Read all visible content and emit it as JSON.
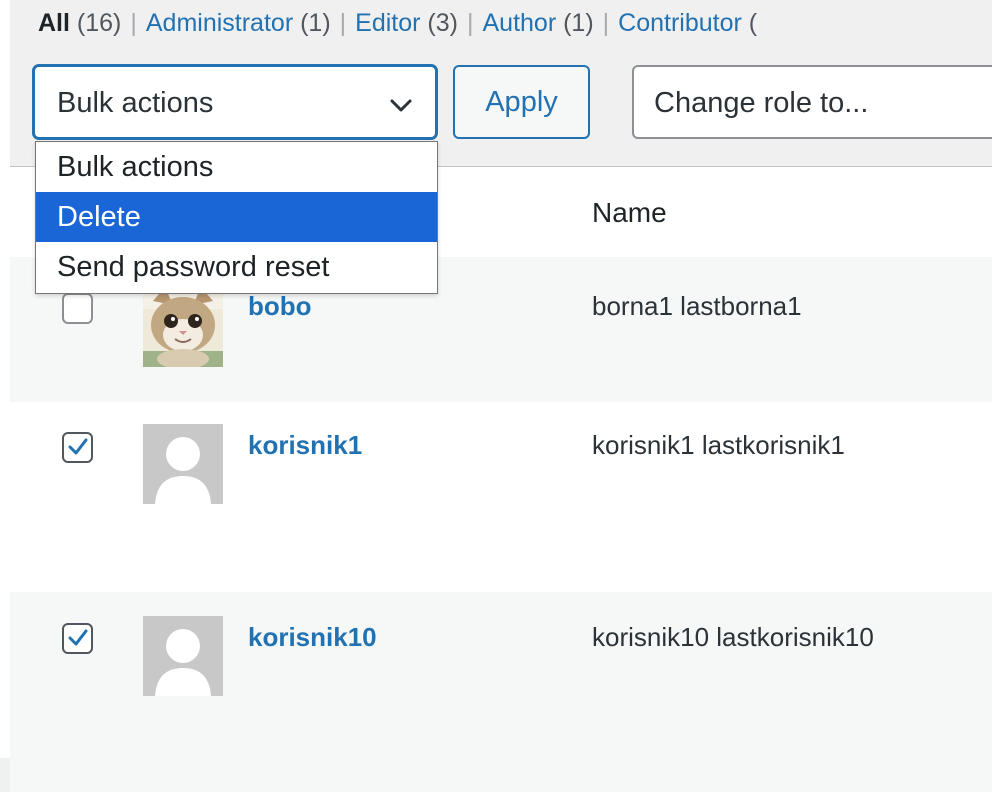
{
  "filters": {
    "all_label": "All",
    "all_count": "(16)",
    "links": [
      {
        "label": "Administrator",
        "count": "(1)"
      },
      {
        "label": "Editor",
        "count": "(3)"
      },
      {
        "label": "Author",
        "count": "(1)"
      },
      {
        "label": "Contributor",
        "count": "("
      }
    ],
    "separator": "|"
  },
  "toolbar": {
    "bulk_actions_value": "Bulk actions",
    "apply_label": "Apply",
    "change_role_value": "Change role to..."
  },
  "bulk_dropdown": {
    "options": [
      "Bulk actions",
      "Delete",
      "Send password reset"
    ],
    "highlighted": "Delete"
  },
  "table": {
    "columns": {
      "name": "Name"
    },
    "rows": [
      {
        "username": "bobo",
        "name": "borna1 lastborna1",
        "checked": false,
        "avatar": "cat-photo"
      },
      {
        "username": "korisnik1",
        "name": "korisnik1 lastkorisnik1",
        "checked": true,
        "avatar": "default-avatar"
      },
      {
        "username": "korisnik10",
        "name": "korisnik10 lastkorisnik10",
        "checked": true,
        "avatar": "default-avatar"
      }
    ]
  },
  "colors": {
    "link": "#2271b1",
    "highlight": "#1a66d6",
    "row_alt": "#f6f7f7"
  }
}
